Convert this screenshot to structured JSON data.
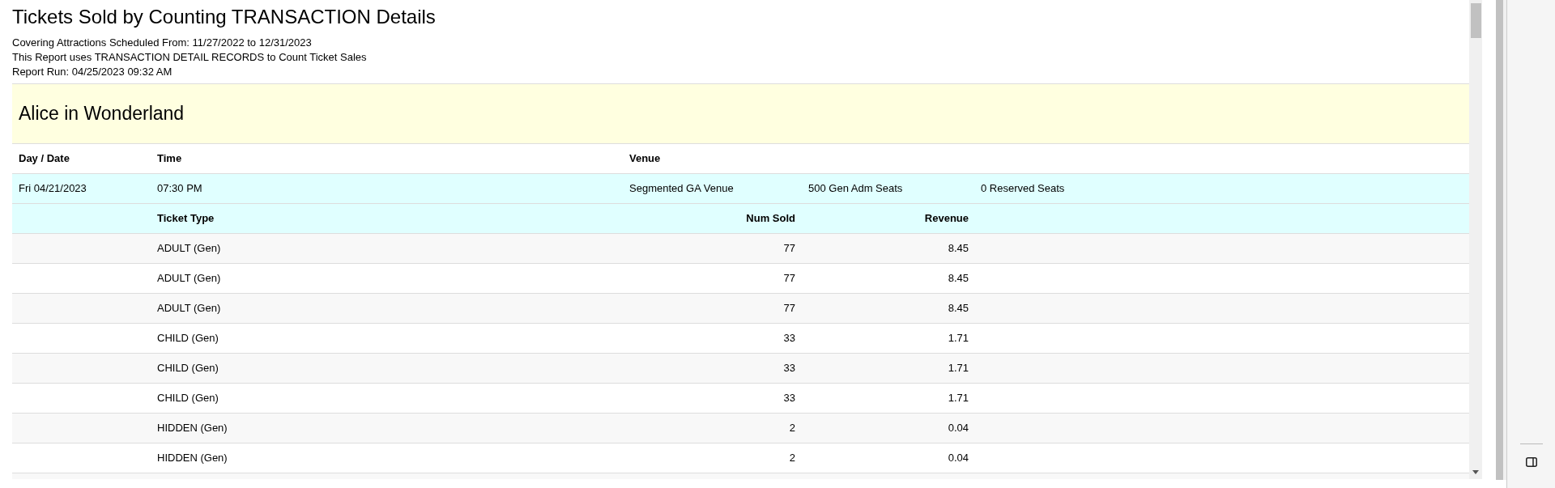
{
  "report": {
    "title": "Tickets Sold by Counting TRANSACTION Details",
    "info_lines": [
      "Covering Attractions Scheduled From: 11/27/2022 to 12/31/2023",
      "This Report uses TRANSACTION DETAIL RECORDS to Count Ticket Sales",
      "Report Run: 04/25/2023 09:32 AM"
    ]
  },
  "event": {
    "name": "Alice in Wonderland",
    "columns": [
      "Day / Date",
      "Time",
      "Venue"
    ],
    "performance": {
      "date": "Fri 04/21/2023",
      "time": "07:30 PM",
      "venue": "Segmented GA Venue",
      "gen_adm_seats": "500 Gen Adm Seats",
      "reserved_seats": "0 Reserved Seats"
    },
    "ticket_columns": [
      "Ticket Type",
      "Num Sold",
      "Revenue"
    ],
    "tickets": [
      {
        "type": "ADULT (Gen)",
        "num_sold": "77",
        "revenue": "8.45"
      },
      {
        "type": "ADULT (Gen)",
        "num_sold": "77",
        "revenue": "8.45"
      },
      {
        "type": "ADULT (Gen)",
        "num_sold": "77",
        "revenue": "8.45"
      },
      {
        "type": "CHILD (Gen)",
        "num_sold": "33",
        "revenue": "1.71"
      },
      {
        "type": "CHILD (Gen)",
        "num_sold": "33",
        "revenue": "1.71"
      },
      {
        "type": "CHILD (Gen)",
        "num_sold": "33",
        "revenue": "1.71"
      },
      {
        "type": "HIDDEN (Gen)",
        "num_sold": "2",
        "revenue": "0.04"
      },
      {
        "type": "HIDDEN (Gen)",
        "num_sold": "2",
        "revenue": "0.04"
      }
    ]
  }
}
